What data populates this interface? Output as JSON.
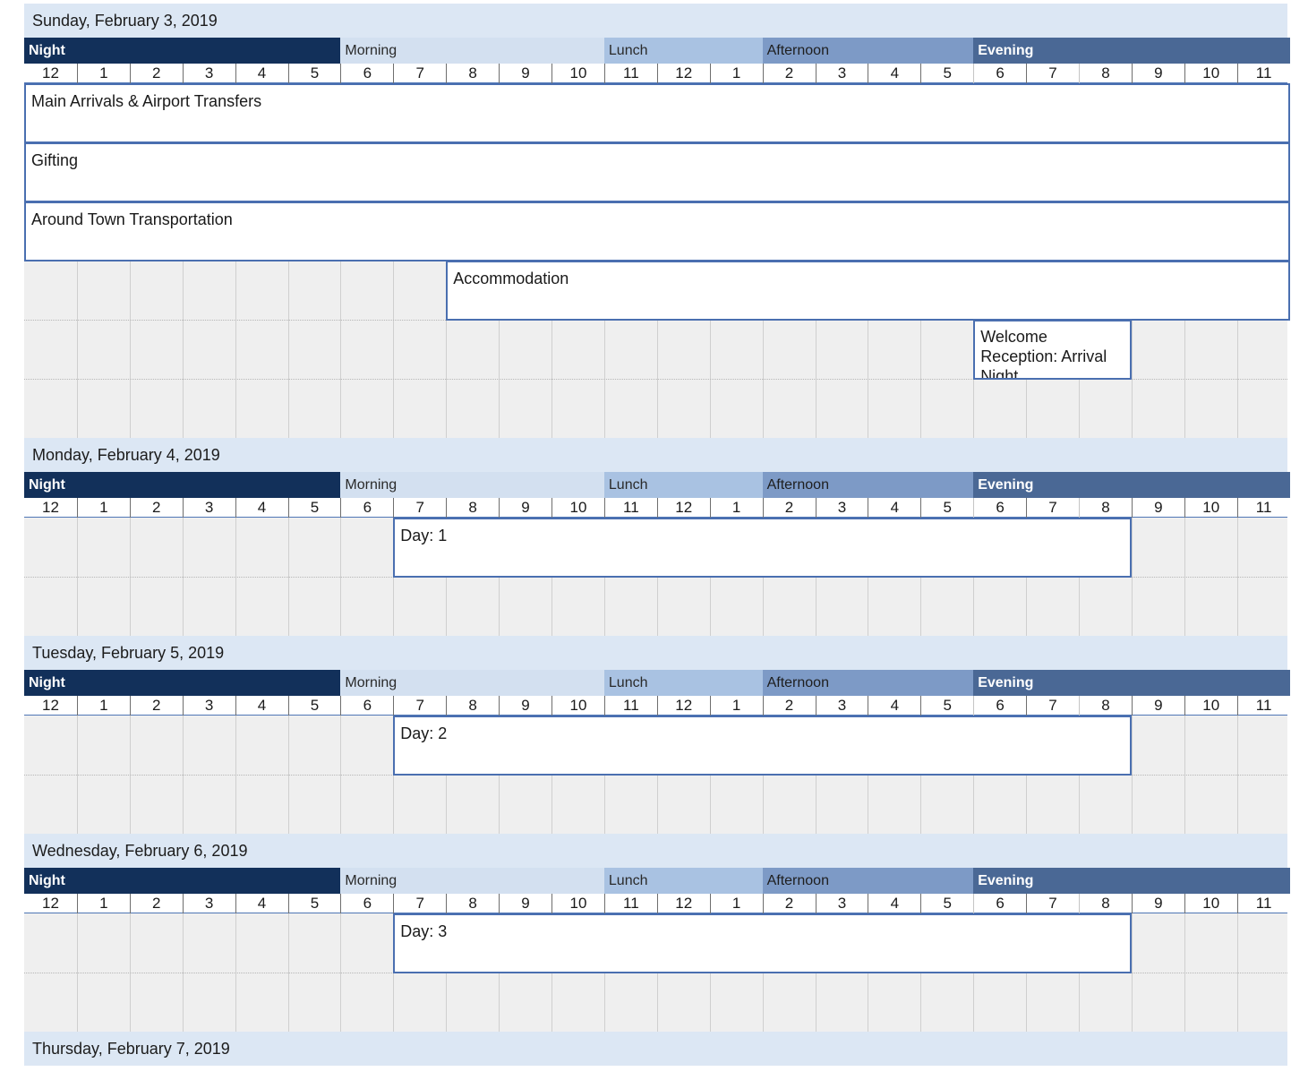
{
  "hours": [
    "12",
    "1",
    "2",
    "3",
    "4",
    "5",
    "6",
    "7",
    "8",
    "9",
    "10",
    "11",
    "12",
    "1",
    "2",
    "3",
    "4",
    "5",
    "6",
    "7",
    "8",
    "9",
    "10",
    "11"
  ],
  "periods": [
    {
      "key": "night",
      "label": "Night",
      "start": 0,
      "end": 6
    },
    {
      "key": "morning",
      "label": "Morning",
      "start": 6,
      "end": 11
    },
    {
      "key": "lunch",
      "label": "Lunch",
      "start": 11,
      "end": 14
    },
    {
      "key": "afternoon",
      "label": "Afternoon",
      "start": 14,
      "end": 18
    },
    {
      "key": "evening",
      "label": "Evening",
      "start": 18,
      "end": 24
    }
  ],
  "days": [
    {
      "date": "Sunday, February 3, 2019",
      "rows": 6,
      "events": [
        {
          "title": "Main Arrivals & Airport Transfers",
          "row": 0,
          "start": 0,
          "end": 24
        },
        {
          "title": "Gifting",
          "row": 1,
          "start": 0,
          "end": 24
        },
        {
          "title": "Around Town Transportation",
          "row": 2,
          "start": 0,
          "end": 24
        },
        {
          "title": "Accommodation",
          "row": 3,
          "start": 8,
          "end": 24
        },
        {
          "title": "Welcome Reception: Arrival Night",
          "row": 4,
          "start": 18,
          "end": 21
        }
      ]
    },
    {
      "date": "Monday, February 4, 2019",
      "rows": 2,
      "events": [
        {
          "title": "Day: 1",
          "row": 0,
          "start": 7,
          "end": 21
        }
      ]
    },
    {
      "date": "Tuesday, February 5, 2019",
      "rows": 2,
      "events": [
        {
          "title": "Day: 2",
          "row": 0,
          "start": 7,
          "end": 21
        }
      ]
    },
    {
      "date": "Wednesday, February 6, 2019",
      "rows": 2,
      "events": [
        {
          "title": "Day: 3",
          "row": 0,
          "start": 7,
          "end": 21
        }
      ]
    },
    {
      "date": "Thursday, February 7, 2019",
      "rows": 0,
      "events": []
    }
  ]
}
